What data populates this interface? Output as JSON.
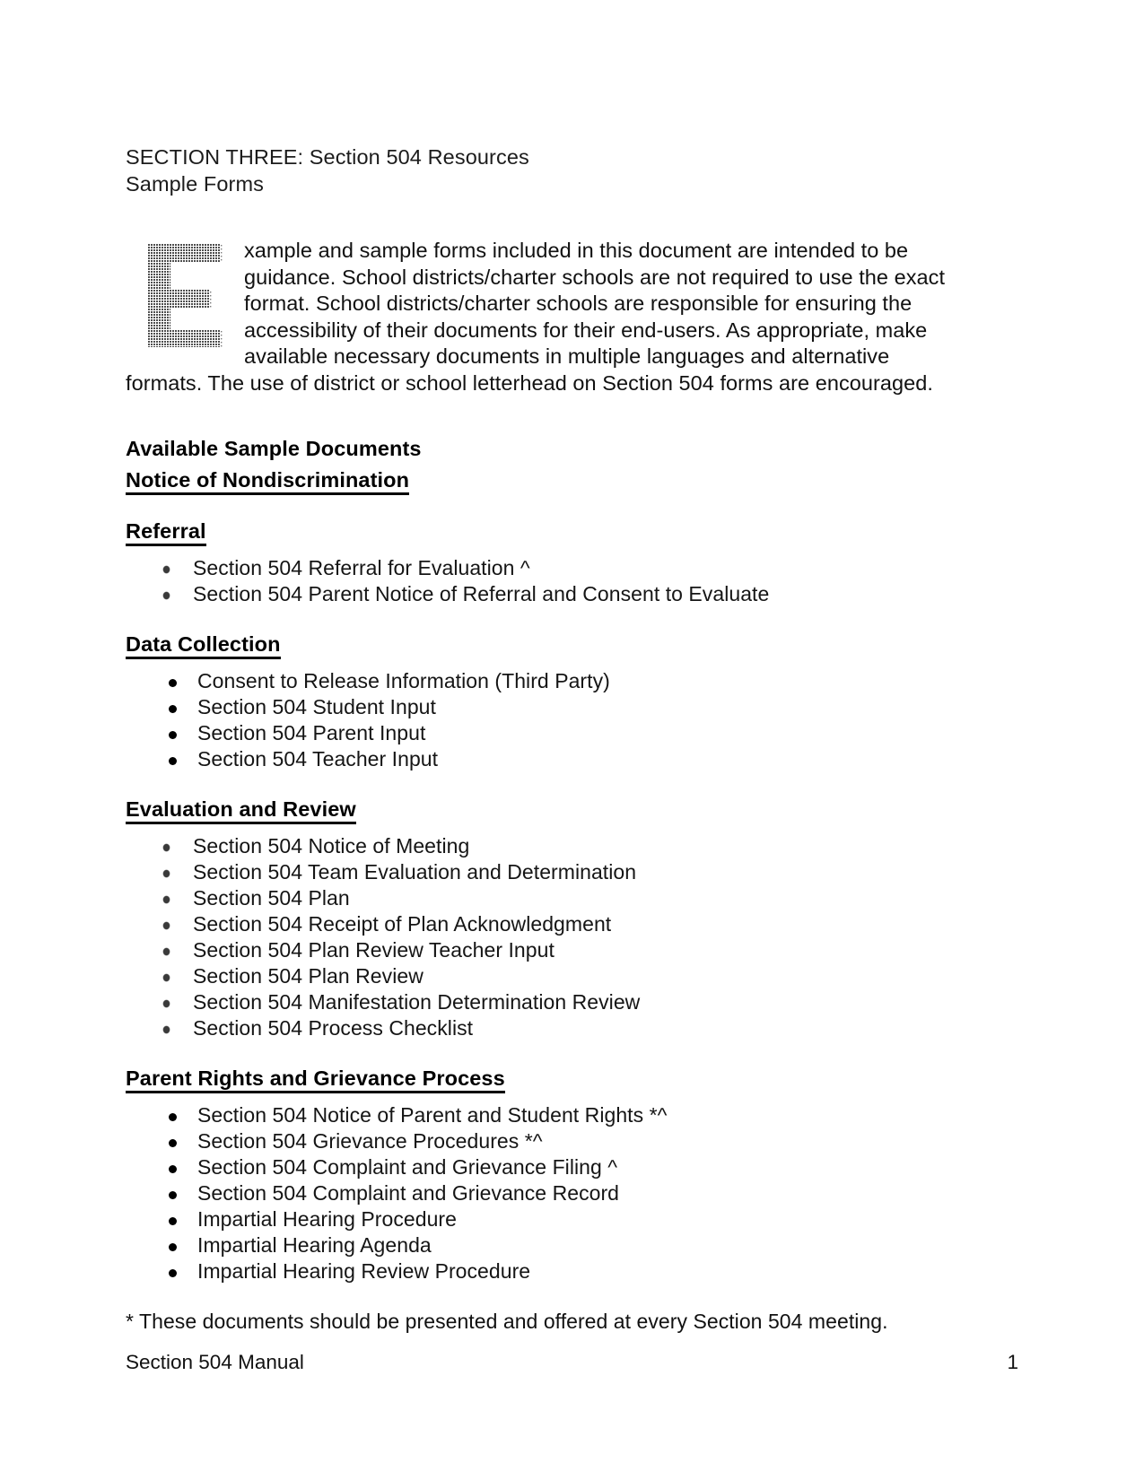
{
  "running_head": {
    "line1": "SECTION THREE: Section 504 Resources",
    "line2": "Sample Forms"
  },
  "intro": {
    "dropcap_letter": "E",
    "dropcap_style": "halftone-gray",
    "text": "xample and sample forms included in this document are intended to be guidance.  School districts/charter schools are not required to use the exact format.  School districts/charter schools are responsible for ensuring the accessibility of their documents for their end-users.  As appropriate, make available necessary documents in multiple languages and alternative formats.  The use of district or school letterhead on Section 504 forms are encouraged."
  },
  "headings": {
    "available_sample_documents": "Available Sample Documents",
    "notice_of_nondiscrimination": "Notice of Nondiscrimination",
    "referral": "Referral",
    "data_collection": "Data Collection",
    "evaluation_and_review": "Evaluation and Review",
    "parent_rights": "Parent Rights and Grievance Process"
  },
  "lists": {
    "referral": [
      "Section 504 Referral for Evaluation ^",
      "Section 504 Parent Notice of Referral and Consent to Evaluate"
    ],
    "data_collection": [
      "Consent to Release Information (Third Party)",
      "Section 504 Student Input",
      "Section 504 Parent Input",
      "Section 504 Teacher Input"
    ],
    "evaluation_and_review": [
      "Section 504 Notice of Meeting",
      "Section 504 Team Evaluation and Determination",
      "Section 504 Plan",
      "Section 504 Receipt of Plan Acknowledgment",
      "Section 504 Plan Review Teacher Input",
      "Section 504 Plan Review",
      "Section 504 Manifestation Determination Review",
      "Section 504 Process Checklist"
    ],
    "parent_rights": [
      "Section 504 Notice of Parent and Student Rights *^",
      "Section 504 Grievance Procedures *^",
      "Section 504 Complaint and Grievance Filing ^",
      "Section 504 Complaint and Grievance Record",
      "Impartial Hearing Procedure",
      "Impartial Hearing Agenda",
      "Impartial Hearing Review Procedure"
    ]
  },
  "footnote": "* These documents should be presented and offered at every Section 504 meeting.",
  "footer": {
    "document_title": "Section 504 Manual",
    "page_number": "1"
  },
  "colors": {
    "text": "#000000",
    "page_background": "#ffffff",
    "dropcap_gray": "#6e6e6e"
  }
}
